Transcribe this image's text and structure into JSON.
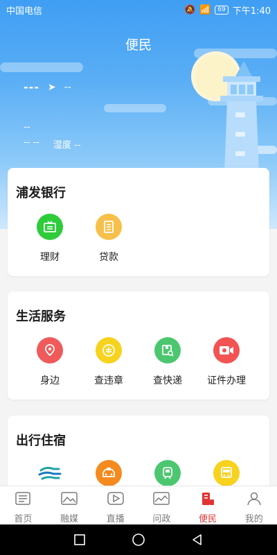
{
  "status_bar": {
    "carrier": "中国电信",
    "battery": "69",
    "time": "下午1:40"
  },
  "page_title": "便民",
  "weather": {
    "temp": "---",
    "location": "--",
    "condition": "--",
    "temp_range": "-- --",
    "humidity_label": "湿度",
    "humidity_value": "--"
  },
  "sections": [
    {
      "title": "浦发银行",
      "items": [
        {
          "label": "理财",
          "icon": "tv-icon",
          "color": "#2ecc3a"
        },
        {
          "label": "贷款",
          "icon": "document-icon",
          "color": "#f7c04a"
        }
      ]
    },
    {
      "title": "生活服务",
      "items": [
        {
          "label": "身边",
          "icon": "location-pin-icon",
          "color": "#f05a5a"
        },
        {
          "label": "查违章",
          "icon": "violation-icon",
          "color": "#f7d21e"
        },
        {
          "label": "查快递",
          "icon": "package-search-icon",
          "color": "#4cc76f"
        },
        {
          "label": "证件办理",
          "icon": "video-camera-icon",
          "color": "#f25454"
        }
      ]
    },
    {
      "title": "出行住宿",
      "items": [
        {
          "label": "",
          "icon": "wave-logo-icon",
          "color": "#1fa3a6"
        },
        {
          "label": "",
          "icon": "taxi-icon",
          "color": "#f58a1f"
        },
        {
          "label": "",
          "icon": "train-icon",
          "color": "#4cc76f"
        },
        {
          "label": "",
          "icon": "bus-icon",
          "color": "#f7d21e"
        }
      ]
    }
  ],
  "tabs": [
    {
      "label": "首页",
      "icon": "news-icon",
      "active": false
    },
    {
      "label": "融媒",
      "icon": "image-icon",
      "active": false
    },
    {
      "label": "直播",
      "icon": "play-icon",
      "active": false
    },
    {
      "label": "问政",
      "icon": "chart-image-icon",
      "active": false
    },
    {
      "label": "便民",
      "icon": "convenience-icon",
      "active": true
    },
    {
      "label": "我的",
      "icon": "person-icon",
      "active": false
    }
  ],
  "colors": {
    "accent": "#e23333",
    "hero_top": "#3f9ef3"
  }
}
